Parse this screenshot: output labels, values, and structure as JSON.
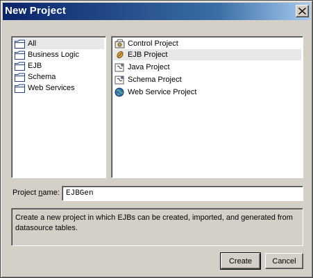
{
  "window": {
    "title": "New Project"
  },
  "categories": [
    {
      "label": "All",
      "icon": "folder-icon",
      "selected": true
    },
    {
      "label": "Business Logic",
      "icon": "folder-icon"
    },
    {
      "label": "EJB",
      "icon": "folder-icon"
    },
    {
      "label": "Schema",
      "icon": "folder-icon"
    },
    {
      "label": "Web Services",
      "icon": "folder-icon"
    }
  ],
  "project_types": [
    {
      "label": "Control Project",
      "icon": "control-project-icon"
    },
    {
      "label": "EJB Project",
      "icon": "ejb-project-icon",
      "selected": true
    },
    {
      "label": "Java Project",
      "icon": "java-project-icon"
    },
    {
      "label": "Schema Project",
      "icon": "schema-project-icon"
    },
    {
      "label": "Web Service Project",
      "icon": "web-service-project-icon"
    }
  ],
  "project_name": {
    "label_prefix": "Project ",
    "label_mnemonic": "n",
    "label_suffix": "ame:",
    "value": "EJBGen"
  },
  "description": "Create a new project in which EJBs can be created, imported, and generated from datasource tables.",
  "buttons": {
    "create": "Create",
    "cancel": "Cancel"
  },
  "colors": {
    "titlebar_start": "#0a246a",
    "titlebar_end": "#a6caf0",
    "face": "#d4d0c8"
  }
}
